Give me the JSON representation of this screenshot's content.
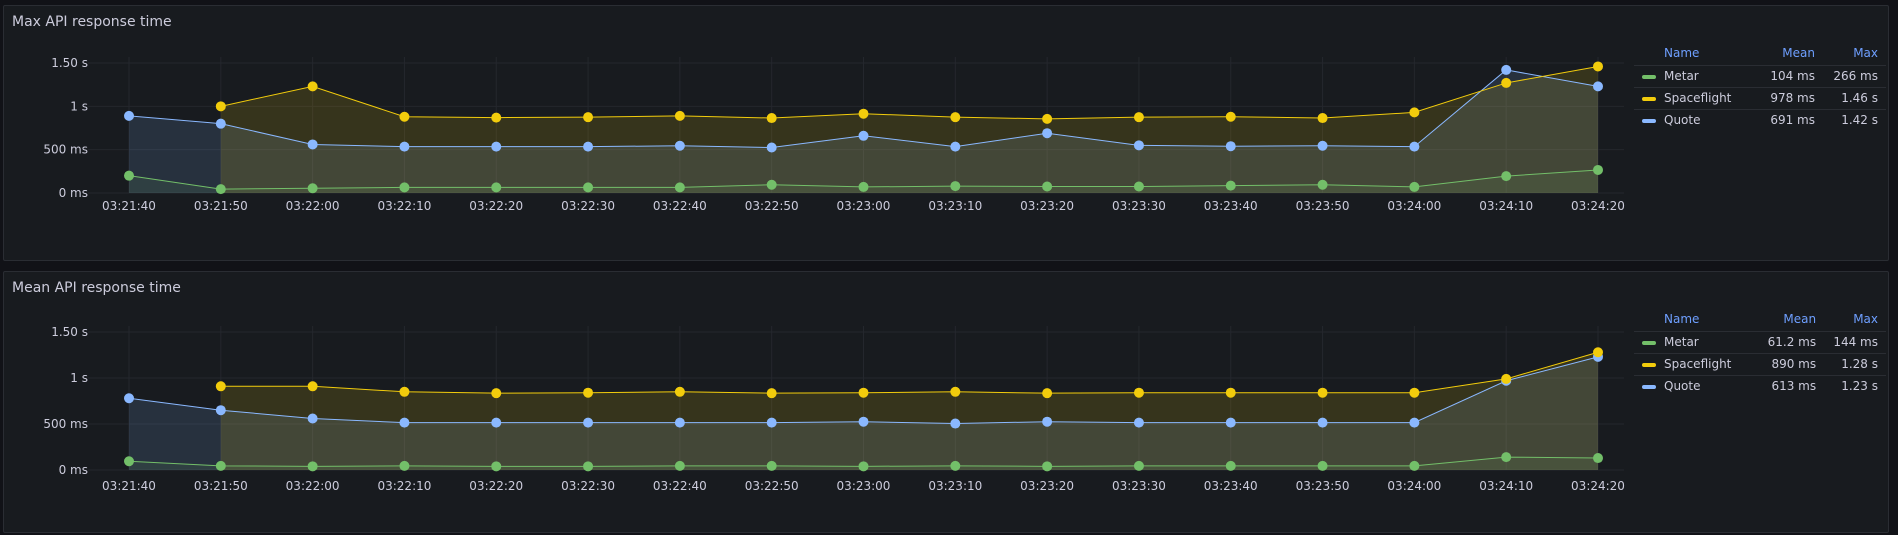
{
  "panels": [
    {
      "title": "Max API response time",
      "legend": {
        "header": {
          "name": "Name",
          "mean": "Mean",
          "max": "Max"
        },
        "rows": [
          {
            "name": "Metar",
            "mean": "104 ms",
            "max": "266 ms"
          },
          {
            "name": "Spaceflight",
            "mean": "978 ms",
            "max": "1.46 s"
          },
          {
            "name": "Quote",
            "mean": "691 ms",
            "max": "1.42 s"
          }
        ]
      }
    },
    {
      "title": "Mean API response time",
      "legend": {
        "header": {
          "name": "Name",
          "mean": "Mean",
          "max": "Max"
        },
        "rows": [
          {
            "name": "Metar",
            "mean": "61.2 ms",
            "max": "144 ms"
          },
          {
            "name": "Spaceflight",
            "mean": "890 ms",
            "max": "1.28 s"
          },
          {
            "name": "Quote",
            "mean": "613 ms",
            "max": "1.23 s"
          }
        ]
      }
    }
  ],
  "chart_data": [
    {
      "type": "area",
      "title": "Max API response time",
      "x": [
        "03:21:40",
        "03:21:50",
        "03:22:00",
        "03:22:10",
        "03:22:20",
        "03:22:30",
        "03:22:40",
        "03:22:50",
        "03:23:00",
        "03:23:10",
        "03:23:20",
        "03:23:30",
        "03:23:40",
        "03:23:50",
        "03:24:00",
        "03:24:10",
        "03:24:20"
      ],
      "y_unit": "ms",
      "ylim": [
        0,
        1500
      ],
      "y_ticks": [
        {
          "value": 1500,
          "label": "1.50 s"
        },
        {
          "value": 1000,
          "label": "1 s"
        },
        {
          "value": 500,
          "label": "500 ms"
        },
        {
          "value": 0,
          "label": "0 ms"
        }
      ],
      "grid": true,
      "legend_placement": "right",
      "series": [
        {
          "name": "Metar",
          "color": "#73bf69",
          "values": [
            200,
            45,
            55,
            65,
            65,
            65,
            65,
            95,
            70,
            80,
            75,
            75,
            85,
            95,
            70,
            195,
            266
          ]
        },
        {
          "name": "Spaceflight",
          "color": "#f2cc0c",
          "values": [
            null,
            1000,
            1230,
            880,
            870,
            875,
            890,
            865,
            915,
            875,
            855,
            875,
            880,
            865,
            930,
            1270,
            1460
          ]
        },
        {
          "name": "Quote",
          "color": "#8ab8ff",
          "values": [
            890,
            800,
            560,
            535,
            535,
            535,
            545,
            525,
            660,
            535,
            690,
            550,
            540,
            545,
            535,
            1420,
            1230
          ]
        }
      ]
    },
    {
      "type": "area",
      "title": "Mean API response time",
      "x": [
        "03:21:40",
        "03:21:50",
        "03:22:00",
        "03:22:10",
        "03:22:20",
        "03:22:30",
        "03:22:40",
        "03:22:50",
        "03:23:00",
        "03:23:10",
        "03:23:20",
        "03:23:30",
        "03:23:40",
        "03:23:50",
        "03:24:00",
        "03:24:10",
        "03:24:20"
      ],
      "y_unit": "ms",
      "ylim": [
        0,
        1500
      ],
      "y_ticks": [
        {
          "value": 1500,
          "label": "1.50 s"
        },
        {
          "value": 1000,
          "label": "1 s"
        },
        {
          "value": 500,
          "label": "500 ms"
        },
        {
          "value": 0,
          "label": "0 ms"
        }
      ],
      "grid": true,
      "legend_placement": "right",
      "series": [
        {
          "name": "Metar",
          "color": "#73bf69",
          "values": [
            95,
            45,
            40,
            45,
            40,
            40,
            45,
            45,
            40,
            45,
            40,
            45,
            45,
            45,
            45,
            140,
            130
          ]
        },
        {
          "name": "Spaceflight",
          "color": "#f2cc0c",
          "values": [
            null,
            910,
            910,
            850,
            835,
            840,
            850,
            835,
            840,
            850,
            835,
            840,
            840,
            840,
            840,
            990,
            1280
          ]
        },
        {
          "name": "Quote",
          "color": "#8ab8ff",
          "values": [
            780,
            650,
            560,
            515,
            515,
            515,
            515,
            515,
            525,
            505,
            525,
            515,
            515,
            515,
            515,
            970,
            1230
          ]
        }
      ]
    }
  ]
}
